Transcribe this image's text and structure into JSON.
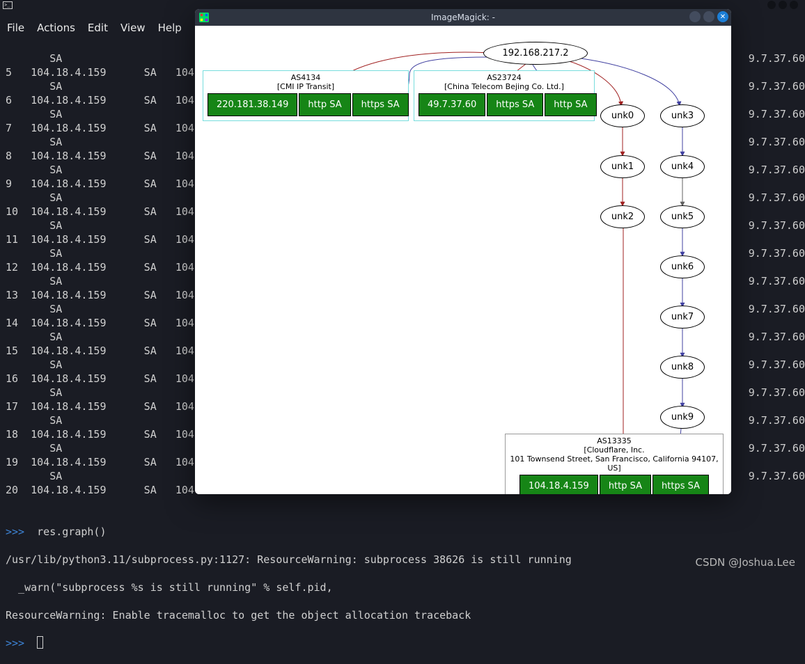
{
  "menubar": {
    "file": "File",
    "actions": "Actions",
    "edit": "Edit",
    "view": "View",
    "help": "Help"
  },
  "window": {
    "title": "ImageMagick: -"
  },
  "terminal": {
    "rows": [
      {
        "n": "",
        "a": "",
        "b": "SA",
        "c": ""
      },
      {
        "n": "5",
        "a": "104.18.4.159",
        "b": "SA",
        "c": "104."
      },
      {
        "n": "",
        "a": "",
        "b": "SA",
        "c": ""
      },
      {
        "n": "6",
        "a": "104.18.4.159",
        "b": "SA",
        "c": "104."
      },
      {
        "n": "",
        "a": "",
        "b": "SA",
        "c": ""
      },
      {
        "n": "7",
        "a": "104.18.4.159",
        "b": "SA",
        "c": "104."
      },
      {
        "n": "",
        "a": "",
        "b": "SA",
        "c": ""
      },
      {
        "n": "8",
        "a": "104.18.4.159",
        "b": "SA",
        "c": "104."
      },
      {
        "n": "",
        "a": "",
        "b": "SA",
        "c": ""
      },
      {
        "n": "9",
        "a": "104.18.4.159",
        "b": "SA",
        "c": "104."
      },
      {
        "n": "",
        "a": "",
        "b": "SA",
        "c": ""
      },
      {
        "n": "10",
        "a": "104.18.4.159",
        "b": "SA",
        "c": "104."
      },
      {
        "n": "",
        "a": "",
        "b": "SA",
        "c": ""
      },
      {
        "n": "11",
        "a": "104.18.4.159",
        "b": "SA",
        "c": "104."
      },
      {
        "n": "",
        "a": "",
        "b": "SA",
        "c": ""
      },
      {
        "n": "12",
        "a": "104.18.4.159",
        "b": "SA",
        "c": "104."
      },
      {
        "n": "",
        "a": "",
        "b": "SA",
        "c": ""
      },
      {
        "n": "13",
        "a": "104.18.4.159",
        "b": "SA",
        "c": "104."
      },
      {
        "n": "",
        "a": "",
        "b": "SA",
        "c": ""
      },
      {
        "n": "14",
        "a": "104.18.4.159",
        "b": "SA",
        "c": "104."
      },
      {
        "n": "",
        "a": "",
        "b": "SA",
        "c": ""
      },
      {
        "n": "15",
        "a": "104.18.4.159",
        "b": "SA",
        "c": "104."
      },
      {
        "n": "",
        "a": "",
        "b": "SA",
        "c": ""
      },
      {
        "n": "16",
        "a": "104.18.4.159",
        "b": "SA",
        "c": "104."
      },
      {
        "n": "",
        "a": "",
        "b": "SA",
        "c": ""
      },
      {
        "n": "17",
        "a": "104.18.4.159",
        "b": "SA",
        "c": "104."
      },
      {
        "n": "",
        "a": "",
        "b": "SA",
        "c": ""
      },
      {
        "n": "18",
        "a": "104.18.4.159",
        "b": "SA",
        "c": "104."
      },
      {
        "n": "",
        "a": "",
        "b": "SA",
        "c": ""
      },
      {
        "n": "19",
        "a": "104.18.4.159",
        "b": "SA",
        "c": "104."
      },
      {
        "n": "",
        "a": "",
        "b": "SA",
        "c": ""
      },
      {
        "n": "20",
        "a": "104.18.4.159",
        "b": "SA",
        "c": "104."
      }
    ],
    "right_rows": [
      "9.7.37.60",
      "9.7.37.60",
      "9.7.37.60",
      "9.7.37.60",
      "9.7.37.60",
      "9.7.37.60",
      "9.7.37.60",
      "9.7.37.60",
      "9.7.37.60",
      "9.7.37.60",
      "9.7.37.60",
      "9.7.37.60",
      "9.7.37.60",
      "9.7.37.60",
      "9.7.37.60",
      "9.7.37.60"
    ],
    "prompt": {
      "sym": ">>>",
      "cmd": "res.graph()"
    },
    "warn1": "/usr/lib/python3.11/subprocess.py:1127: ResourceWarning: subprocess 38626 is still running",
    "warn2": "  _warn(\"subprocess %s is still running\" % self.pid,",
    "warn3": "ResourceWarning: Enable tracemalloc to get the object allocation traceback",
    "prompt2_sym": ">>>"
  },
  "graph": {
    "root": "192.168.217.2",
    "as1": {
      "asn": "AS4134",
      "org": "[CMI IP Transit]",
      "cells": [
        "220.181.38.149",
        "http SA",
        "https SA"
      ]
    },
    "as2": {
      "asn": "AS23724",
      "org": "[China Telecom Bejing Co. Ltd.]",
      "cells": [
        "49.7.37.60",
        "https SA",
        "http SA"
      ]
    },
    "as3": {
      "asn": "AS13335",
      "org": "[Cloudflare, Inc.",
      "addr": "101 Townsend Street, San Francisco, California 94107, US]",
      "cells": [
        "104.18.4.159",
        "http SA",
        "https SA"
      ]
    },
    "unk": [
      "unk0",
      "unk1",
      "unk2",
      "unk3",
      "unk4",
      "unk5",
      "unk6",
      "unk7",
      "unk8",
      "unk9"
    ]
  },
  "watermark": "CSDN @Joshua.Lee"
}
